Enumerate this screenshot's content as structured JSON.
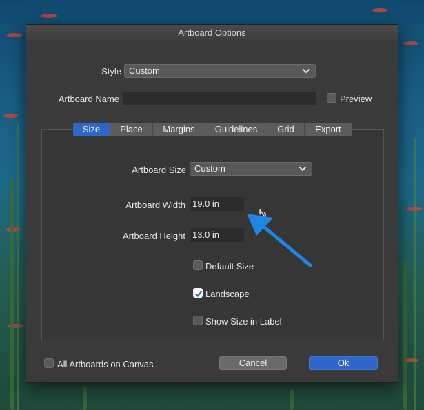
{
  "dialog": {
    "title": "Artboard Options",
    "style_label": "Style",
    "style_value": "Custom",
    "name_label": "Artboard Name",
    "name_value": "",
    "preview_label": "Preview",
    "preview_checked": false
  },
  "tabs": [
    {
      "label": "Size",
      "active": true
    },
    {
      "label": "Place",
      "active": false
    },
    {
      "label": "Margins",
      "active": false
    },
    {
      "label": "Guidelines",
      "active": false
    },
    {
      "label": "Grid",
      "active": false
    },
    {
      "label": "Export",
      "active": false
    }
  ],
  "size_tab": {
    "size_label": "Artboard Size",
    "size_value": "Custom",
    "width_label": "Artboard Width",
    "width_value": "19.0 in",
    "height_label": "Artboard Height",
    "height_value": "13.0 in",
    "default_size_label": "Default Size",
    "default_size_checked": false,
    "landscape_label": "Landscape",
    "landscape_checked": true,
    "show_size_label": "Show Size in Label",
    "show_size_checked": false
  },
  "footer": {
    "all_artboards_label": "All Artboards on Canvas",
    "all_artboards_checked": false,
    "cancel_label": "Cancel",
    "ok_label": "Ok"
  },
  "colors": {
    "accent": "#2e67c7",
    "annotation_arrow": "#1f86e8"
  },
  "icons": {
    "dropdown": "chevron-down-icon",
    "link": "link-icon",
    "check": "checkmark-icon",
    "annotation": "arrow-icon"
  }
}
